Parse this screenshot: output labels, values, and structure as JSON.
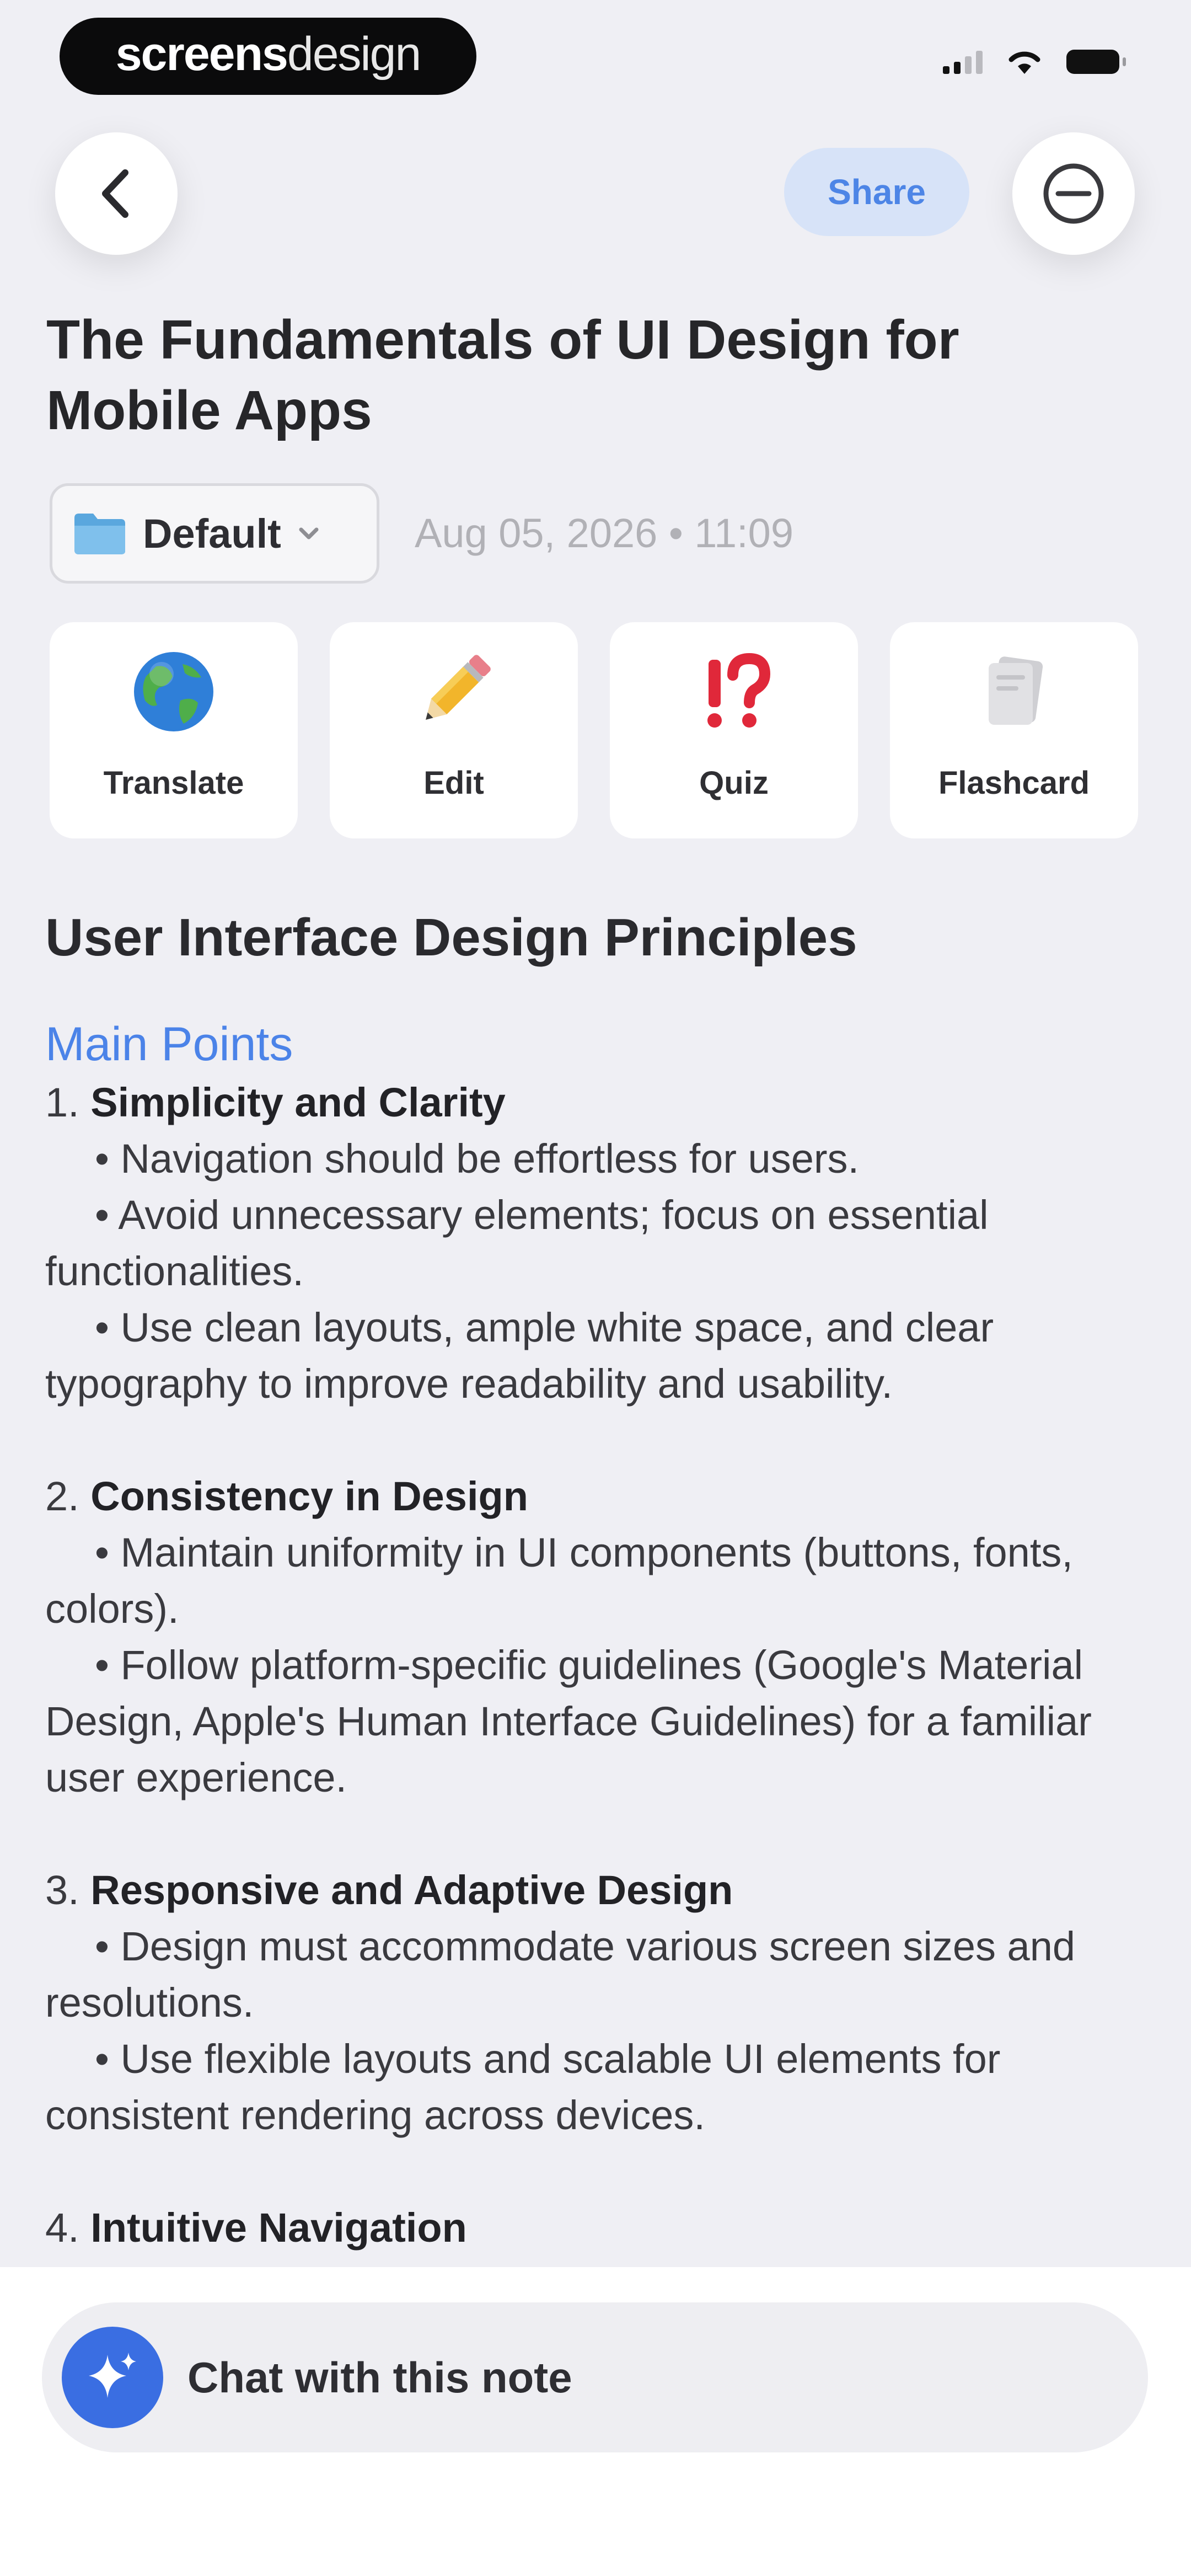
{
  "status_bar": {
    "watermark_bold": "screens",
    "watermark_light": "design",
    "icons": [
      "cellular-signal-icon",
      "wifi-icon",
      "battery-icon"
    ]
  },
  "nav": {
    "back_icon": "chevron-left-icon",
    "share_label": "Share",
    "more_icon": "minus-circle-icon"
  },
  "note": {
    "title": "The Fundamentals of UI Design for Mobile Apps",
    "folder": {
      "icon": "folder-icon",
      "label": "Default"
    },
    "date": "Aug 05, 2026 • 11:09",
    "actions": [
      {
        "label": "Translate",
        "icon": "globe-icon"
      },
      {
        "label": "Edit",
        "icon": "pencil-icon"
      },
      {
        "label": "Quiz",
        "icon": "exclamation-question-icon"
      },
      {
        "label": "Flashcard",
        "icon": "cards-icon"
      }
    ],
    "heading": "User Interface Design Principles",
    "section_title": "Main Points",
    "points": [
      {
        "number": "1.",
        "title": "Simplicity and Clarity",
        "bullets": [
          "Navigation should be effortless for users.",
          "Avoid unnecessary elements; focus on essential functionalities.",
          "Use clean layouts, ample white space, and clear typography to improve readability and usability."
        ]
      },
      {
        "number": "2.",
        "title": "Consistency in Design",
        "bullets": [
          "Maintain uniformity in UI components (buttons, fonts, colors).",
          "Follow platform-specific guidelines (Google's Material Design, Apple's Human Interface Guidelines) for a familiar user experience."
        ]
      },
      {
        "number": "3.",
        "title": "Responsive and Adaptive Design",
        "bullets": [
          "Design must accommodate various screen sizes and resolutions.",
          "Use flexible layouts and scalable UI elements for consistent rendering across devices."
        ]
      },
      {
        "number": "4.",
        "title": "Intuitive Navigation",
        "bullets": []
      }
    ]
  },
  "chat": {
    "icon": "sparkles-icon",
    "label": "Chat with this note"
  },
  "colors": {
    "background": "#efeff4",
    "accent": "#4b83e8",
    "share_bg": "#d7e3f8",
    "chat_icon_bg": "#3a6ee2"
  }
}
